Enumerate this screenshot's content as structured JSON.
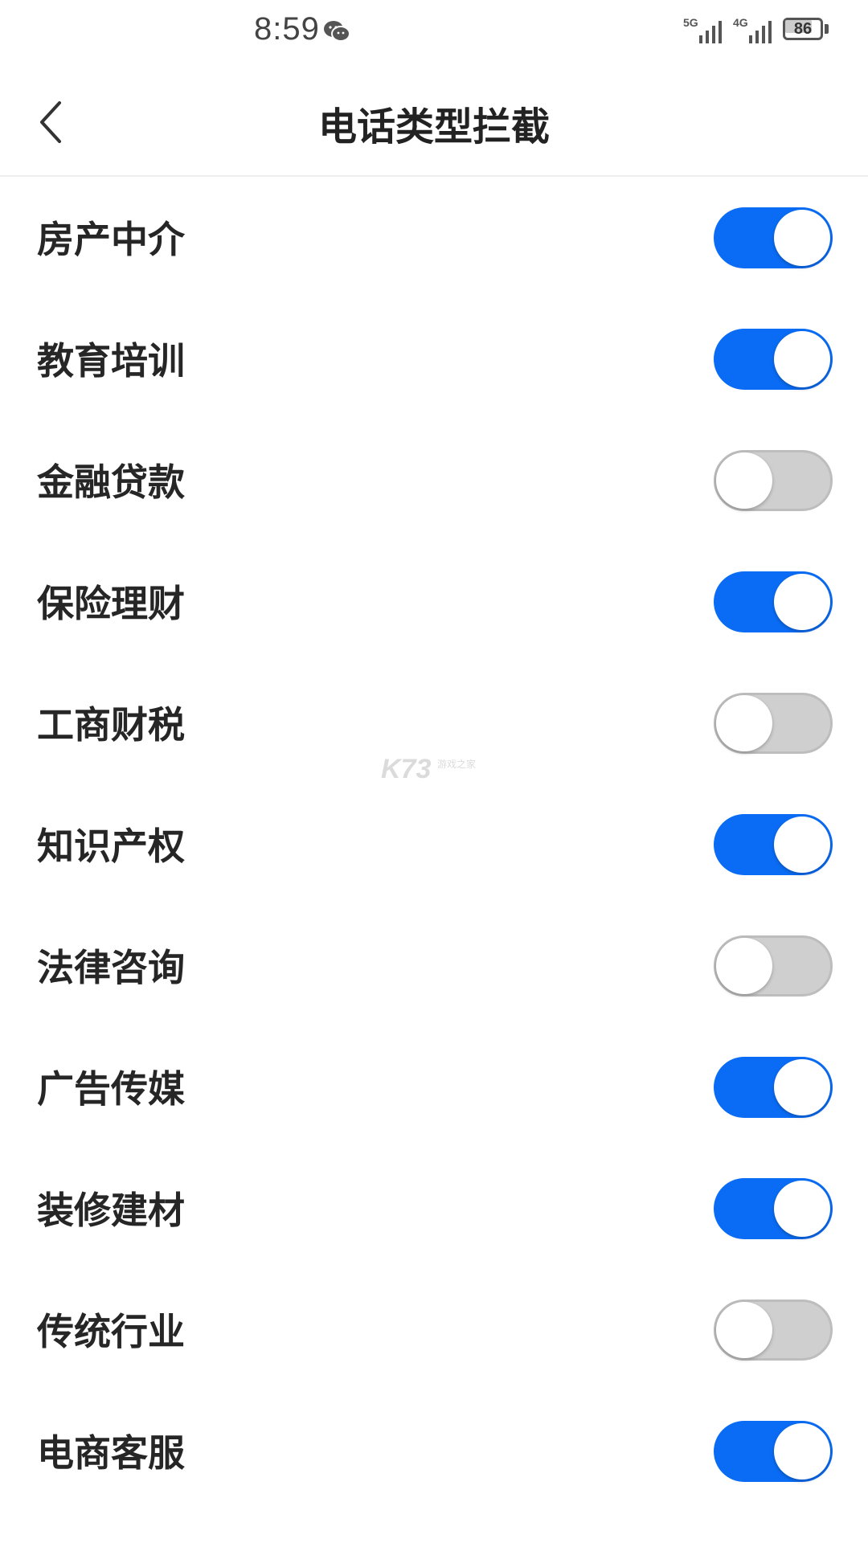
{
  "status_bar": {
    "time": "8:59",
    "network_1": "5G",
    "network_2": "4G",
    "battery_level": 86,
    "battery_text": "86",
    "icons": [
      "wechat-icon",
      "signal-icon",
      "battery-icon"
    ]
  },
  "header": {
    "title": "电话类型拦截",
    "back_icon": "chevron-left-icon"
  },
  "colors": {
    "toggle_on": "#0a6cf5",
    "toggle_off": "#cfcfcf",
    "text": "#262626"
  },
  "items": [
    {
      "label": "房产中介",
      "enabled": true
    },
    {
      "label": "教育培训",
      "enabled": true
    },
    {
      "label": "金融贷款",
      "enabled": false
    },
    {
      "label": "保险理财",
      "enabled": true
    },
    {
      "label": "工商财税",
      "enabled": false
    },
    {
      "label": "知识产权",
      "enabled": true
    },
    {
      "label": "法律咨询",
      "enabled": false
    },
    {
      "label": "广告传媒",
      "enabled": true
    },
    {
      "label": "装修建材",
      "enabled": true
    },
    {
      "label": "传统行业",
      "enabled": false
    },
    {
      "label": "电商客服",
      "enabled": true
    }
  ],
  "watermark": {
    "text": "K73",
    "small": "游戏之家"
  }
}
